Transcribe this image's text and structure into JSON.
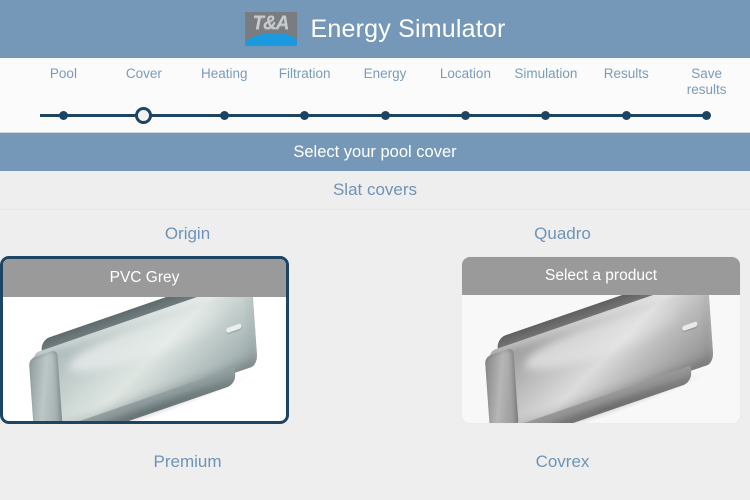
{
  "header": {
    "logo_text": "T&A",
    "logo_icon": "ta-wave-logo",
    "title": "Energy Simulator"
  },
  "stepper": {
    "current_step": "Cover",
    "steps": [
      {
        "label": "Pool",
        "state": "done"
      },
      {
        "label": "Cover",
        "state": "current"
      },
      {
        "label": "Heating",
        "state": "todo"
      },
      {
        "label": "Filtration",
        "state": "todo"
      },
      {
        "label": "Energy",
        "state": "todo"
      },
      {
        "label": "Location",
        "state": "todo"
      },
      {
        "label": "Simulation",
        "state": "todo"
      },
      {
        "label": "Results",
        "state": "todo"
      },
      {
        "label": "Save results",
        "state": "todo"
      }
    ]
  },
  "banner": {
    "text": "Select your pool cover"
  },
  "group": {
    "heading": "Slat covers"
  },
  "products": {
    "row1": [
      {
        "title": "Origin",
        "card_label": "PVC Grey",
        "selected": true,
        "image": "pvc-slat-grey-green"
      },
      {
        "title": "Quadro",
        "card_label": "Select a product",
        "selected": false,
        "image": "pvc-slat-grey"
      }
    ],
    "row2": [
      {
        "title": "Premium"
      },
      {
        "title": "Covrex"
      }
    ]
  },
  "colors": {
    "header_blue": "#7598b8",
    "accent_navy": "#1d4463",
    "label_blue": "#6f93b7",
    "card_head_grey": "#9a9a9a",
    "page_bg": "#eeeeee",
    "logo_wave_blue": "#1b9ae0"
  }
}
